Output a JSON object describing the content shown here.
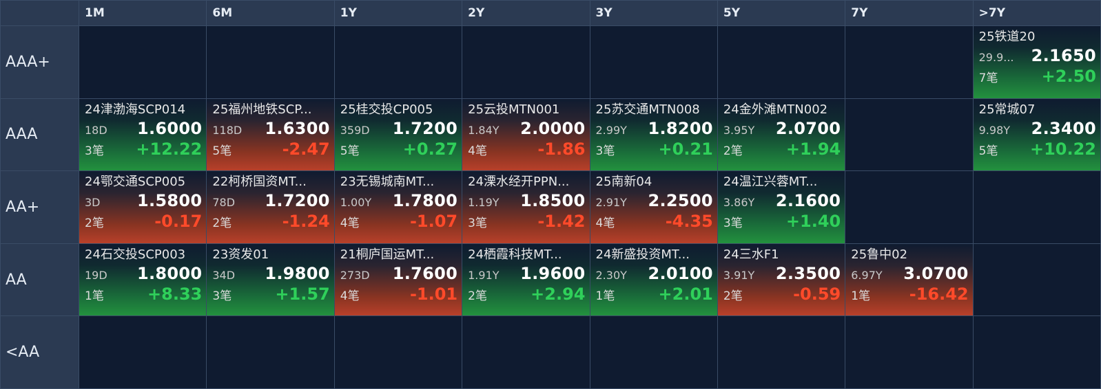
{
  "columns": [
    "1M",
    "6M",
    "1Y",
    "2Y",
    "3Y",
    "5Y",
    "7Y",
    ">7Y"
  ],
  "rows": [
    {
      "rating": "AAA+",
      "cells": [
        null,
        null,
        null,
        null,
        null,
        null,
        null,
        {
          "name": "25铁道20",
          "term": "29.9...",
          "yield": "2.1650",
          "count": "7笔",
          "change": "+2.50",
          "dir": "up"
        }
      ]
    },
    {
      "rating": "AAA",
      "cells": [
        {
          "name": "24津渤海SCP014",
          "term": "18D",
          "yield": "1.6000",
          "count": "3笔",
          "change": "+12.22",
          "dir": "up"
        },
        {
          "name": "25福州地铁SCP...",
          "term": "118D",
          "yield": "1.6300",
          "count": "5笔",
          "change": "-2.47",
          "dir": "down"
        },
        {
          "name": "25桂交投CP005",
          "term": "359D",
          "yield": "1.7200",
          "count": "5笔",
          "change": "+0.27",
          "dir": "up"
        },
        {
          "name": "25云投MTN001",
          "term": "1.84Y",
          "yield": "2.0000",
          "count": "4笔",
          "change": "-1.86",
          "dir": "down"
        },
        {
          "name": "25苏交通MTN008",
          "term": "2.99Y",
          "yield": "1.8200",
          "count": "3笔",
          "change": "+0.21",
          "dir": "up"
        },
        {
          "name": "24金外滩MTN002",
          "term": "3.95Y",
          "yield": "2.0700",
          "count": "2笔",
          "change": "+1.94",
          "dir": "up"
        },
        null,
        {
          "name": "25常城07",
          "term": "9.98Y",
          "yield": "2.3400",
          "count": "5笔",
          "change": "+10.22",
          "dir": "up"
        }
      ]
    },
    {
      "rating": "AA+",
      "cells": [
        {
          "name": "24鄂交通SCP005",
          "term": "3D",
          "yield": "1.5800",
          "count": "2笔",
          "change": "-0.17",
          "dir": "down"
        },
        {
          "name": "22柯桥国资MT...",
          "term": "78D",
          "yield": "1.7200",
          "count": "2笔",
          "change": "-1.24",
          "dir": "down"
        },
        {
          "name": "23无锡城南MT...",
          "term": "1.00Y",
          "yield": "1.7800",
          "count": "4笔",
          "change": "-1.07",
          "dir": "down"
        },
        {
          "name": "24溧水经开PPN...",
          "term": "1.19Y",
          "yield": "1.8500",
          "count": "3笔",
          "change": "-1.42",
          "dir": "down"
        },
        {
          "name": "25南新04",
          "term": "2.91Y",
          "yield": "2.2500",
          "count": "4笔",
          "change": "-4.35",
          "dir": "down"
        },
        {
          "name": "24温江兴蓉MT...",
          "term": "3.86Y",
          "yield": "2.1600",
          "count": "3笔",
          "change": "+1.40",
          "dir": "up"
        },
        null,
        null
      ]
    },
    {
      "rating": "AA",
      "cells": [
        {
          "name": "24石交投SCP003",
          "term": "19D",
          "yield": "1.8000",
          "count": "1笔",
          "change": "+8.33",
          "dir": "up"
        },
        {
          "name": "23资发01",
          "term": "34D",
          "yield": "1.9800",
          "count": "3笔",
          "change": "+1.57",
          "dir": "up"
        },
        {
          "name": "21桐庐国运MT...",
          "term": "273D",
          "yield": "1.7600",
          "count": "4笔",
          "change": "-1.01",
          "dir": "down"
        },
        {
          "name": "24栖霞科技MT...",
          "term": "1.91Y",
          "yield": "1.9600",
          "count": "2笔",
          "change": "+2.94",
          "dir": "up"
        },
        {
          "name": "24新盛投资MT...",
          "term": "2.30Y",
          "yield": "2.0100",
          "count": "1笔",
          "change": "+2.01",
          "dir": "up"
        },
        {
          "name": "24三水F1",
          "term": "3.91Y",
          "yield": "2.3500",
          "count": "2笔",
          "change": "-0.59",
          "dir": "down"
        },
        {
          "name": "25鲁中02",
          "term": "6.97Y",
          "yield": "3.0700",
          "count": "1笔",
          "change": "-16.42",
          "dir": "down"
        },
        null
      ]
    },
    {
      "rating": "<AA",
      "cells": [
        null,
        null,
        null,
        null,
        null,
        null,
        null,
        null
      ]
    }
  ],
  "colors": {
    "up": "#2fd05a",
    "down": "#ff4a2a",
    "header_bg": "#2b3a52",
    "cell_bg": "#0f1b30"
  }
}
